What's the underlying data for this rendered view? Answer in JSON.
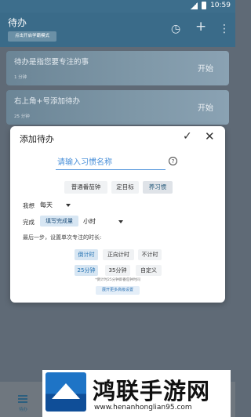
{
  "status_bar": {
    "time": "10:59"
  },
  "header": {
    "title": "待办",
    "mode_chip": "点击开启学霸模式"
  },
  "todos": [
    {
      "title": "待办是指您要专注的事",
      "meta": "1 分钟",
      "start_label": "开始"
    },
    {
      "title": "右上角+号添加待办",
      "meta": "25 分钟",
      "start_label": "开始"
    }
  ],
  "dialog": {
    "title": "添加待办",
    "name_placeholder": "请输入习惯名称",
    "type_options": [
      "普通番茄钟",
      "定目标",
      "养习惯"
    ],
    "want_label": "我想",
    "want_value": "每天",
    "complete_label": "完成",
    "complete_chip": "填写完成量",
    "complete_unit": "小时",
    "last_step": "最后一步，设置单次专注的时长:",
    "timer_options": [
      "倒计时",
      "正向计时",
      "不计时"
    ],
    "duration_options": [
      "25分钟",
      "35分钟",
      "自定义"
    ],
    "note": "*倒计时25分钟即番茄钟时间",
    "more_settings": "展开更多高级设置"
  },
  "bottom_bar": {
    "label": "待办"
  },
  "watermark": {
    "title": "鸿联手游网",
    "url": "www.henanhonglian95.com"
  }
}
